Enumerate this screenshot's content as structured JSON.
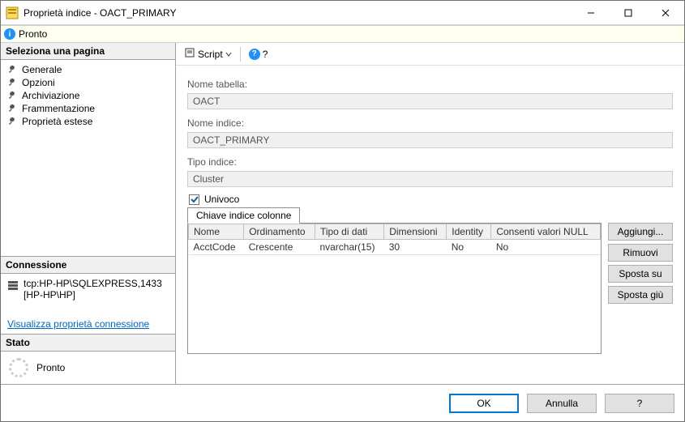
{
  "window": {
    "title": "Proprietà indice - OACT_PRIMARY"
  },
  "status": {
    "text": "Pronto"
  },
  "sidepanel": {
    "select_page_header": "Seleziona una pagina",
    "nav": [
      {
        "label": "Generale"
      },
      {
        "label": "Opzioni"
      },
      {
        "label": "Archiviazione"
      },
      {
        "label": "Frammentazione"
      },
      {
        "label": "Proprietà estese"
      }
    ],
    "connection_header": "Connessione",
    "connection_line1": "tcp:HP-HP\\SQLEXPRESS,1433",
    "connection_line2": "[HP-HP\\HP]",
    "view_conn_link": "Visualizza proprietà connessione",
    "state_header": "Stato",
    "state_text": "Pronto"
  },
  "toolbar": {
    "script_label": "Script",
    "help_glyph": "?"
  },
  "form": {
    "table_label": "Nome tabella:",
    "table_value": "OACT",
    "index_label": "Nome indice:",
    "index_value": "OACT_PRIMARY",
    "type_label": "Tipo indice:",
    "type_value": "Cluster",
    "unique_label": "Univoco"
  },
  "tab": {
    "label": "Chiave indice colonne"
  },
  "grid": {
    "headers": {
      "name": "Nome",
      "order": "Ordinamento",
      "dtype": "Tipo di dati",
      "size": "Dimensioni",
      "identity": "Identity",
      "nulls": "Consenti valori NULL"
    },
    "rows": [
      {
        "name": "AcctCode",
        "order": "Crescente",
        "dtype": "nvarchar(15)",
        "size": "30",
        "identity": "No",
        "nulls": "No"
      }
    ]
  },
  "sidebuttons": {
    "add": "Aggiungi...",
    "remove": "Rimuovi",
    "moveup": "Sposta su",
    "movedown": "Sposta giù"
  },
  "footer": {
    "ok": "OK",
    "cancel": "Annulla",
    "help": "?"
  }
}
